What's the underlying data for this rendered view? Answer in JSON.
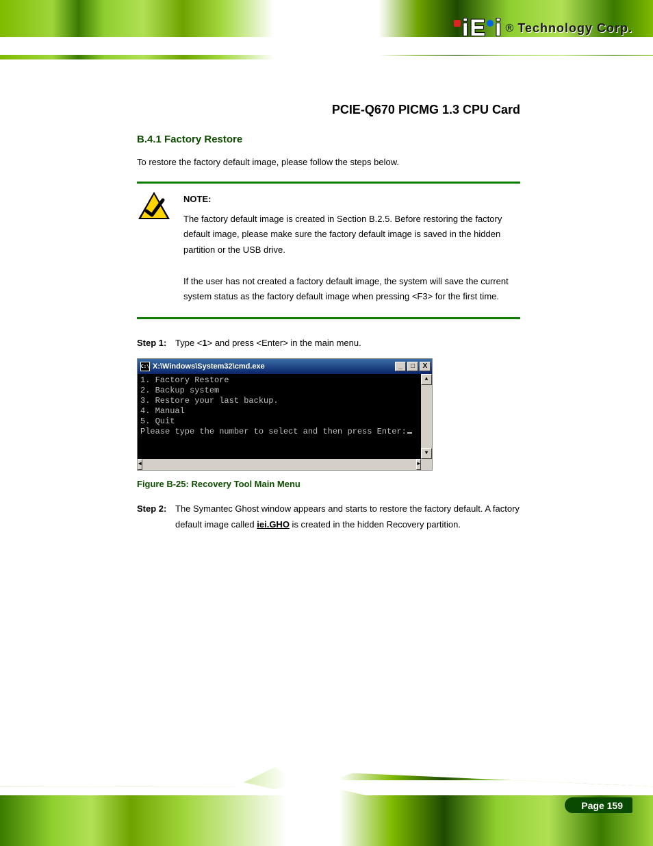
{
  "header": {
    "brand_registered": "®",
    "brand_text": "Technology Corp.",
    "product_title": "PCIE-Q670 PICMG 1.3 CPU Card"
  },
  "section_heading": "B.4.1  Factory Restore",
  "intro": "To restore the factory default image, please follow the steps below.",
  "note": {
    "title": "NOTE:",
    "lines": [
      "The factory default image is created in Section B.2.5. Before restoring the factory default image, please make sure the factory default image is saved in the hidden partition or the USB drive.",
      "If the user has not created a factory default image, the system will save the current system status as the factory default image when pressing <F3> for the first time."
    ]
  },
  "steps": [
    {
      "marker": "Step 1:",
      "text_prefix": "Type <",
      "key": "1",
      "text_suffix": "> and press <Enter> in the main menu."
    },
    {
      "marker": "Step 2:",
      "text_prefix": "The Symantec Ghost window appears and starts to restore the factory default. A factory default image called ",
      "bold": "iei.GHO",
      "text_suffix": " is created in the hidden Recovery partition."
    }
  ],
  "cmd": {
    "title": "X:\\Windows\\System32\\cmd.exe",
    "btn_min": "_",
    "btn_max": "□",
    "btn_close": "X",
    "line1": "1. Factory Restore",
    "line2": "2. Backup system",
    "line3": "3. Restore your last backup.",
    "line4": "4. Manual",
    "line5": "5. Quit",
    "prompt": "Please type the number to select and then press Enter:",
    "scroll_up": "▲",
    "scroll_down": "▼",
    "scroll_left": "◄",
    "scroll_right": "►"
  },
  "figure_caption": "Figure B-25: Recovery Tool Main Menu",
  "page_number": "Page 159"
}
